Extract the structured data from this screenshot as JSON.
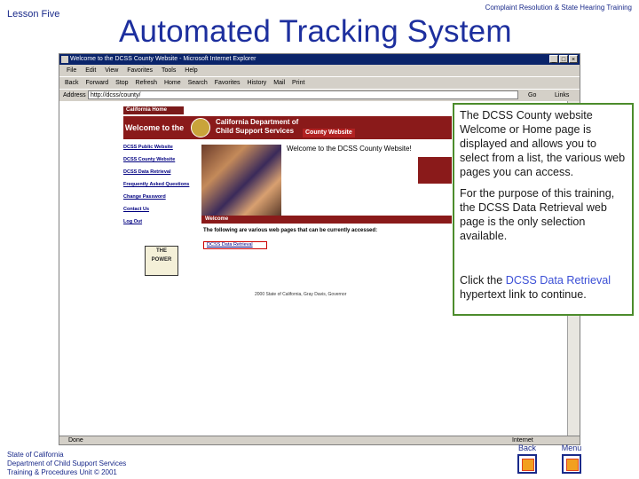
{
  "slide": {
    "lesson": "Lesson Five",
    "course": "Complaint Resolution & State Hearing Training",
    "title": "Automated Tracking System"
  },
  "browser": {
    "window_title": "Welcome to the DCSS County Website - Microsoft Internet Explorer",
    "menu": [
      "File",
      "Edit",
      "View",
      "Favorites",
      "Tools",
      "Help"
    ],
    "toolbar": [
      "Back",
      "Forward",
      "Stop",
      "Refresh",
      "Home",
      "Search",
      "Favorites",
      "History",
      "Mail",
      "Print"
    ],
    "address_label": "Address",
    "address_value": "http://dcss/county/",
    "go_label": "Go",
    "links_label": "Links",
    "status": "Done",
    "zone": "Internet"
  },
  "site": {
    "ca_home": "California Home",
    "welcome_banner": "Welcome to the",
    "dept_line1": "California Department of",
    "dept_line2": "Child Support Services",
    "county_tag": "County Website",
    "nav": [
      "DCSS Public Website",
      "DCSS County Website",
      "DCSS Data Retrieval",
      "Frequently Asked Questions",
      "Change Password",
      "Contact Us",
      "Log Out"
    ],
    "welcome_title": "Welcome to the DCSS County Website!",
    "welcome_bar": "Welcome",
    "list_heading": "The following are various web pages that can be currently accessed:",
    "data_retrieval_link": "DCSS Data Retrieval",
    "logo_text": "THE POWER",
    "copyright": "2000 State of California, Gray Davis, Governor"
  },
  "callout": {
    "p1": "The DCSS County website Welcome or Home page is displayed and allows you to select from a list, the various web pages you can access.",
    "p2": "For the purpose of this training, the DCSS Data Retrieval web page is the only selection available.",
    "p3_before": "Click the ",
    "p3_link": "DCSS Data Retrieval",
    "p3_after": " hypertext link to continue."
  },
  "footer": {
    "line1": "State of California",
    "line2": "Department of Child Support Services",
    "line3": "Training & Procedures Unit © 2001"
  },
  "nav": {
    "back": "Back",
    "menu": "Menu"
  }
}
